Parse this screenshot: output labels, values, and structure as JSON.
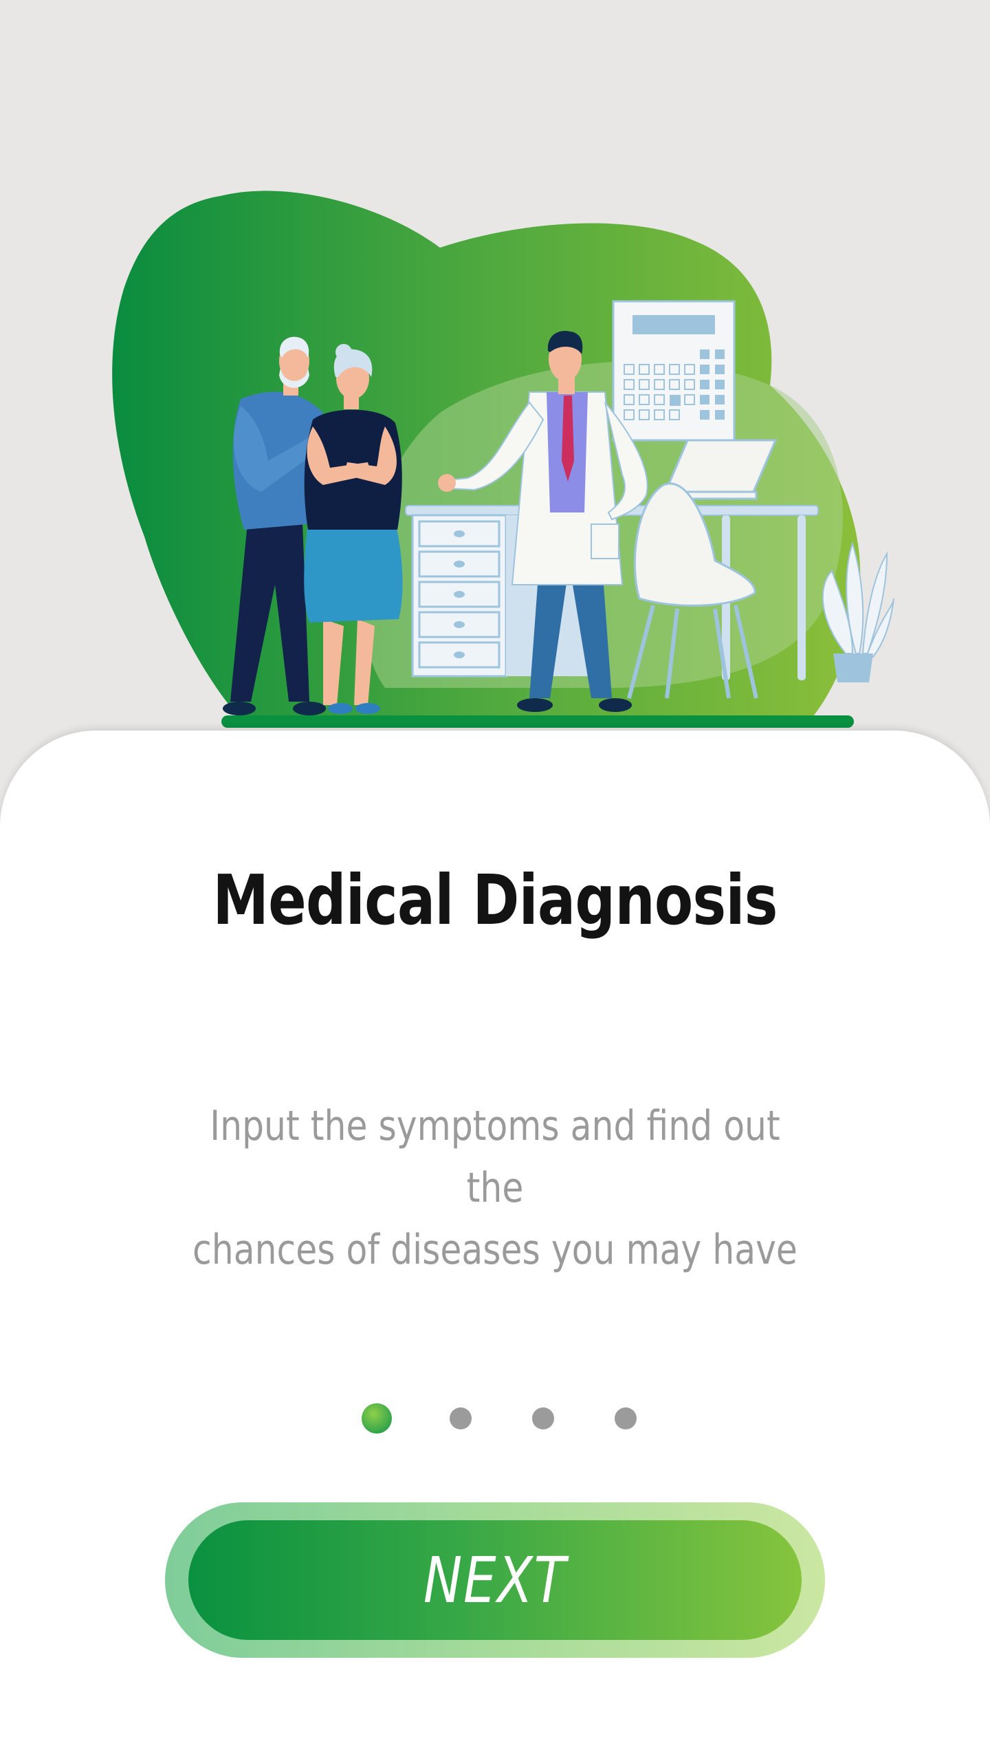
{
  "onboarding": {
    "illustration": "doctor-consultation-illustration",
    "title": "Medical Diagnosis",
    "description_line1": "Input the symptoms and find out the",
    "description_line2": "chances of diseases you may have",
    "pagination": {
      "total": 4,
      "current": 1
    },
    "next_label": "NEXT"
  },
  "colors": {
    "background": "#e9e7e6",
    "card": "#ffffff",
    "accent_green": "#0a9140",
    "accent_lime": "#86c43d",
    "title_text": "#131313",
    "body_text": "#9a9a9a",
    "inactive_dot": "#9b9b9b"
  }
}
